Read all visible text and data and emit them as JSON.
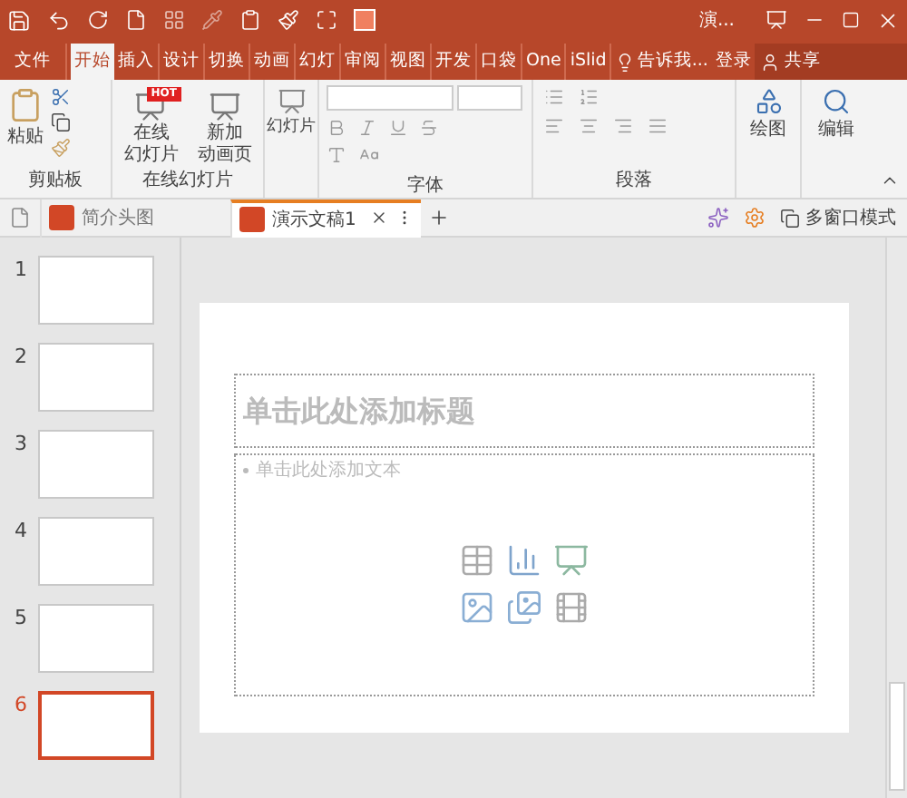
{
  "title_bar": {
    "title": "演..."
  },
  "ribbon_tabs": [
    {
      "label": "文件",
      "selected": false
    },
    {
      "label": "开始",
      "selected": true
    },
    {
      "label": "插入",
      "selected": false
    },
    {
      "label": "设计",
      "selected": false
    },
    {
      "label": "切换",
      "selected": false
    },
    {
      "label": "动画",
      "selected": false
    },
    {
      "label": "幻灯",
      "selected": false
    },
    {
      "label": "审阅",
      "selected": false
    },
    {
      "label": "视图",
      "selected": false
    },
    {
      "label": "开发",
      "selected": false
    },
    {
      "label": "口袋",
      "selected": false
    },
    {
      "label": "One",
      "selected": false
    },
    {
      "label": "iSlid",
      "selected": false
    }
  ],
  "tell_me": "告诉我...",
  "sign_in": "登录",
  "share": "共享",
  "ribbon": {
    "clipboard": {
      "label": "剪贴板",
      "paste": "粘贴"
    },
    "online": {
      "label": "在线幻灯片",
      "hot": "HOT",
      "buttons": [
        {
          "line1": "在线",
          "line2": "幻灯片"
        },
        {
          "line1": "新加",
          "line2": "动画页"
        }
      ]
    },
    "slides": {
      "button": "幻灯片"
    },
    "font": {
      "label": "字体"
    },
    "paragraph": {
      "label": "段落"
    },
    "drawing": {
      "button": "绘图"
    },
    "editing": {
      "button": "编辑"
    }
  },
  "doc_tabs": [
    {
      "label": "简介头图",
      "selected": false
    },
    {
      "label": "演示文稿1",
      "selected": true
    }
  ],
  "multi_window": "多窗口模式",
  "thumbnails": [
    {
      "number": "1",
      "selected": false
    },
    {
      "number": "2",
      "selected": false
    },
    {
      "number": "3",
      "selected": false
    },
    {
      "number": "4",
      "selected": false
    },
    {
      "number": "5",
      "selected": false
    },
    {
      "number": "6",
      "selected": true
    }
  ],
  "slide": {
    "title_placeholder": "单击此处添加标题",
    "body_placeholder": "单击此处添加文本"
  }
}
